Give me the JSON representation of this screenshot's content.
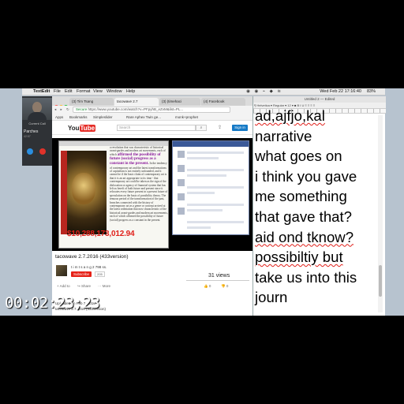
{
  "menubar": {
    "app": "TextEdit",
    "menus": [
      "File",
      "Edit",
      "Format",
      "View",
      "Window",
      "Help"
    ],
    "status": "Wed Feb 22  17:16:40",
    "battery": "83%"
  },
  "call": {
    "label": "Current Call",
    "contact": "Parches",
    "duration": "42:57"
  },
  "browser": {
    "tabs": [
      "(3) Tim Tsang",
      "tacowave 2.7",
      "(3) (timehaci",
      "(4) Facebook"
    ],
    "url": "https://www.youtube.com/watch?v=PFpyhB_eZvM&list=PL...",
    "secure_label": "Secure",
    "bookmarks": [
      "Apps",
      "Bookmarks",
      "Simpleslider",
      "Rare Aphex Twin ge...",
      "monk+prophet"
    ]
  },
  "youtube": {
    "logo_you": "You",
    "logo_tube": "Tube",
    "search_placeholder": "Search",
    "search_icon": "magnifier-icon",
    "upload_icon": "upload-icon",
    "signin_label": "Sign in"
  },
  "video": {
    "doc_paragraph_1": "a revolution that was characteristic of historical avant-gardes and modern art movements, each of which",
    "doc_highlight": "affirmed the possibility of future (social) progress as a constant in the present.",
    "doc_paragraph_2": "In the tendency of contemporary art and the latest transformations of capitalism is not entirely unfounded, and it cannot be if the basic claim of contemporary art is that it is an art appropriate to its time - that contemporary art could be taken as the sign of the dislocation or agency of financial system that has left us bereft of both future and present since it relocates every future present in a present future of speculation on the basis of possibility theory.",
    "doc_paragraph_3": "The tenuous period of the transformation of the past, breaches connected with the history of contemporary art as a genre or concept arrived at the latest orientation that now characteristic of the historical avant-gardes and modern art movements, each of which affirmed the possibility of future (social) progress as a constant in the present.",
    "price_overlay": "$10,288,173,012.94"
  },
  "video_info": {
    "title": "tacowave 2.7.2016 (433version)",
    "channel": "t i m t s a n g 2 798 ss.",
    "subscribe_label": "Subscribe",
    "subscriber_count": "205",
    "views": "31 views",
    "actions": [
      "Add to",
      "Share",
      "More"
    ],
    "likes": "0",
    "dislikes": "0",
    "uploaded": "Uploaded on Feb 7, 2016",
    "description_fragment": "tacowave 2.7.2016 (433version)"
  },
  "textedit": {
    "window_title": "Untitled 2 — Edited",
    "lines": [
      {
        "text": "ad,ajfjo,kal",
        "err": true
      },
      {
        "text": "narrative",
        "err": false
      },
      {
        "text": "what goes on",
        "err": false
      },
      {
        "text": "i think you gave",
        "err": false
      },
      {
        "text": "me something",
        "err": false
      },
      {
        "text": "that gave that?",
        "err": false
      },
      {
        "text": "aid ond tknow?",
        "err": true
      },
      {
        "text": "possibiltiy but",
        "err": true
      },
      {
        "text": "take us into this",
        "err": false
      },
      {
        "text": "journ",
        "err": false
      }
    ]
  },
  "timecode": "00:02:23;23"
}
